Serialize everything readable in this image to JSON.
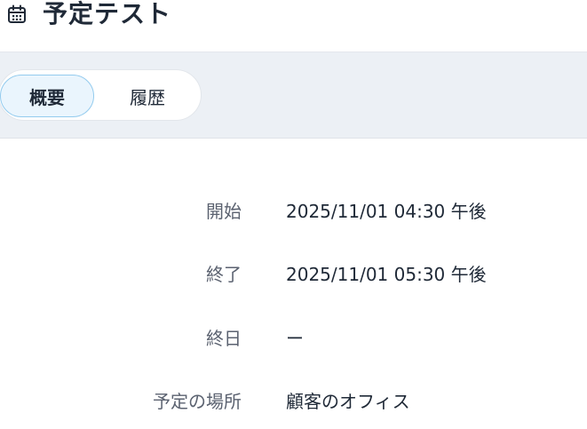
{
  "header": {
    "title": "予定テスト",
    "icon": "calendar-icon"
  },
  "tabs": [
    {
      "label": "概要",
      "active": true
    },
    {
      "label": "履歴",
      "active": false
    }
  ],
  "details": [
    {
      "label": "開始",
      "value": "2025/11/01 04:30 午後"
    },
    {
      "label": "終了",
      "value": "2025/11/01 05:30 午後"
    },
    {
      "label": "終日",
      "value": "ー"
    },
    {
      "label": "予定の場所",
      "value": "顧客のオフィス"
    }
  ],
  "colors": {
    "tab_active_bg": "#eaf5fd",
    "tab_active_border": "#93cbee",
    "tabbar_bg": "#ecf0f5",
    "label_text": "#5b6270",
    "value_text": "#1f2937"
  }
}
